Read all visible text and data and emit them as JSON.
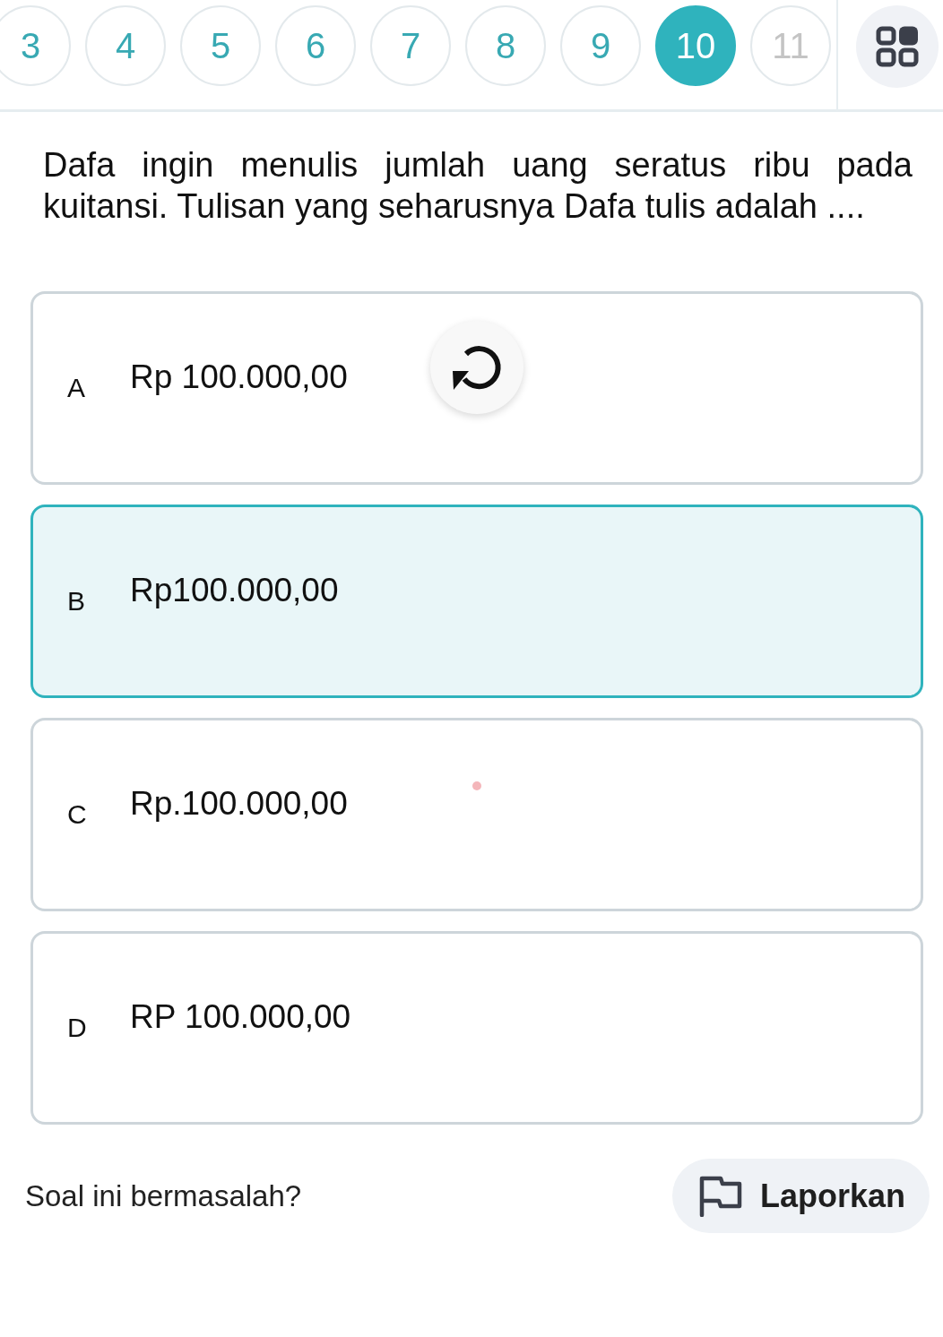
{
  "question_nav": {
    "items": [
      {
        "label": "3",
        "selected": false,
        "answered": true
      },
      {
        "label": "4",
        "selected": false,
        "answered": true
      },
      {
        "label": "5",
        "selected": false,
        "answered": true
      },
      {
        "label": "6",
        "selected": false,
        "answered": true
      },
      {
        "label": "7",
        "selected": false,
        "answered": true
      },
      {
        "label": "8",
        "selected": false,
        "answered": true
      },
      {
        "label": "9",
        "selected": false,
        "answered": true
      },
      {
        "label": "10",
        "selected": true,
        "answered": true
      },
      {
        "label": "11",
        "selected": false,
        "answered": false
      }
    ]
  },
  "question": {
    "text": "Dafa ingin menulis jumlah uang seratus ribu pada kuitansi. Tulisan yang seharusnya Dafa tulis adalah ...."
  },
  "options": [
    {
      "letter": "A",
      "text": "Rp 100.000,00",
      "selected": false
    },
    {
      "letter": "B",
      "text": "Rp100.000,00",
      "selected": true
    },
    {
      "letter": "C",
      "text": "Rp.100.000,00",
      "selected": false
    },
    {
      "letter": "D",
      "text": "RP 100.000,00",
      "selected": false
    }
  ],
  "footer": {
    "prompt": "Soal ini bermasalah?",
    "report_button": "Laporkan"
  }
}
